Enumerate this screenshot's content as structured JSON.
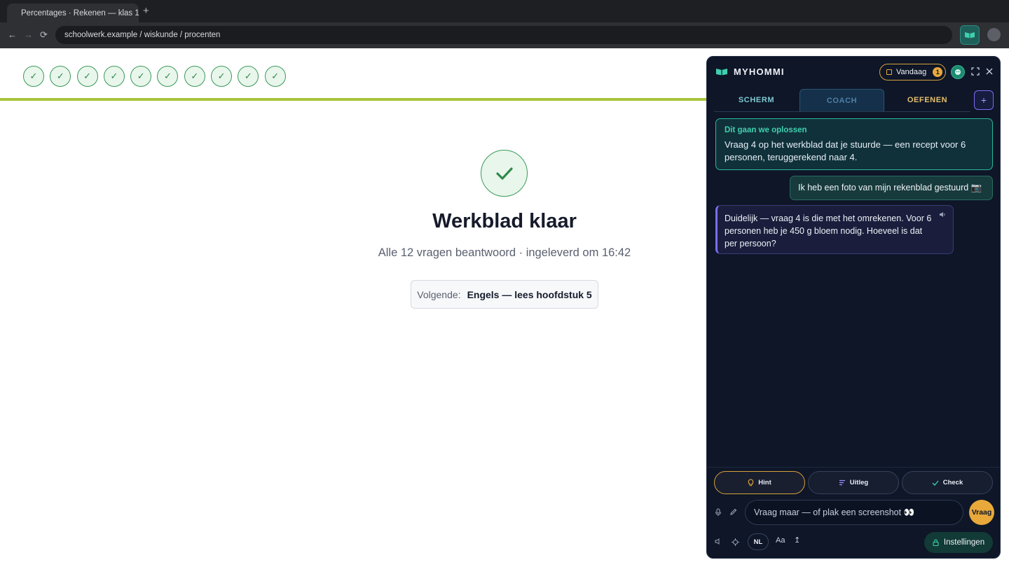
{
  "browser": {
    "tab_title": "Percentages · Rekenen — klas 1",
    "new_tab": "+",
    "back": "←",
    "forward": "→",
    "reload": "⟳",
    "url": "schoolwerk.example / wiskunde / procenten"
  },
  "page": {
    "progress_check": "✓",
    "title": "Werkblad klaar",
    "subtitle": "Alle 12 vragen beantwoord · ingeleverd om 16:42",
    "next_label": "Volgende:",
    "next_value": "Engels — lees hoofdstuk 5"
  },
  "panel": {
    "brand": "MYHOMMI",
    "today_label": "Vandaag",
    "today_count": "1",
    "tabs": [
      {
        "label": "SCHERM"
      },
      {
        "label": "COACH"
      },
      {
        "label": "OEFENEN"
      }
    ],
    "tab_add": "+",
    "solve_title": "Dit gaan we oplossen",
    "solve_text": "Vraag 4 op het werkblad dat je stuurde — een recept voor 6 personen, teruggerekend naar 4.",
    "user_message": "Ik heb een foto van mijn rekenblad gestuurd 📷",
    "bot_message": "Duidelijk — vraag 4 is die met het omrekenen. Voor 6 personen heb je 450 g bloem nodig. Hoeveel is dat per persoon?",
    "actions": {
      "hint": "Hint",
      "uitleg": "Uitleg",
      "check": "Check"
    },
    "input_placeholder": "Vraag maar — of plak een screenshot 👀",
    "ask_button": "Vraag",
    "language": "NL",
    "font_size": "Aa",
    "upload": "↥",
    "settings": "Instellingen"
  },
  "colors": {
    "panel_bg": "#0e1628",
    "accent_teal": "#2bb79a",
    "accent_amber": "#e8a93a",
    "accent_purple": "#7e6cf2",
    "success_green": "#3a9a58",
    "progress_line": "#a8c43c"
  }
}
